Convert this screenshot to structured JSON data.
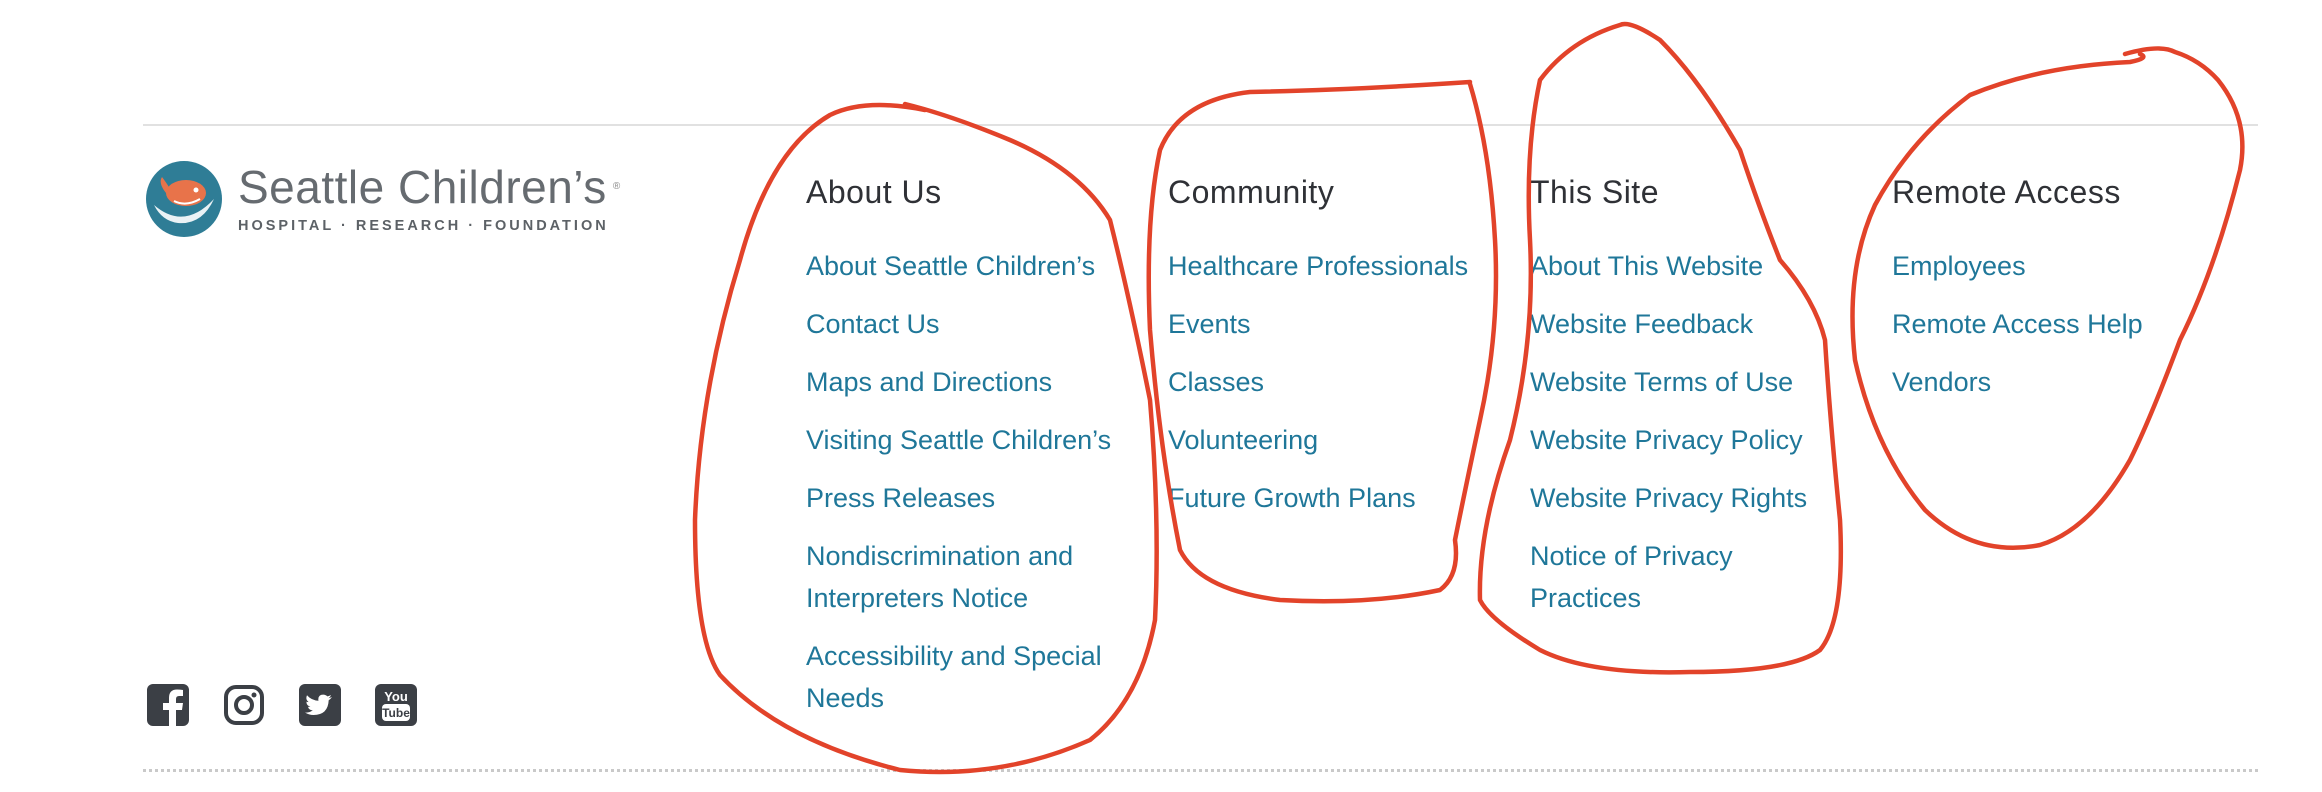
{
  "brand": {
    "name": "Seattle Children’s",
    "tagline": "HOSPITAL · RESEARCH · FOUNDATION",
    "colors": {
      "teal": "#2f7d96",
      "orange": "#e8734a",
      "gray": "#666b70"
    }
  },
  "columns": [
    {
      "heading": "About Us",
      "links": [
        "About Seattle Children’s",
        "Contact Us",
        "Maps and Directions",
        "Visiting Seattle Children’s",
        "Press Releases",
        "Nondiscrimination and Interpreters Notice",
        "Accessibility and Special Needs"
      ]
    },
    {
      "heading": "Community",
      "links": [
        "Healthcare Professionals",
        "Events",
        "Classes",
        "Volunteering",
        "Future Growth Plans"
      ]
    },
    {
      "heading": "This Site",
      "links": [
        "About This Website",
        "Website Feedback",
        "Website Terms of Use",
        "Website Privacy Policy",
        "Website Privacy Rights",
        "Notice of Privacy Practices"
      ]
    },
    {
      "heading": "Remote Access",
      "links": [
        "Employees",
        "Remote Access Help",
        "Vendors"
      ]
    }
  ],
  "social": [
    {
      "icon": "facebook-icon"
    },
    {
      "icon": "instagram-icon"
    },
    {
      "icon": "twitter-icon"
    },
    {
      "icon": "youtube-icon"
    }
  ],
  "colors": {
    "heading": "#2f3136",
    "link": "#1f7799",
    "annotation": "#e2432a",
    "icon": "#3b3f45"
  }
}
